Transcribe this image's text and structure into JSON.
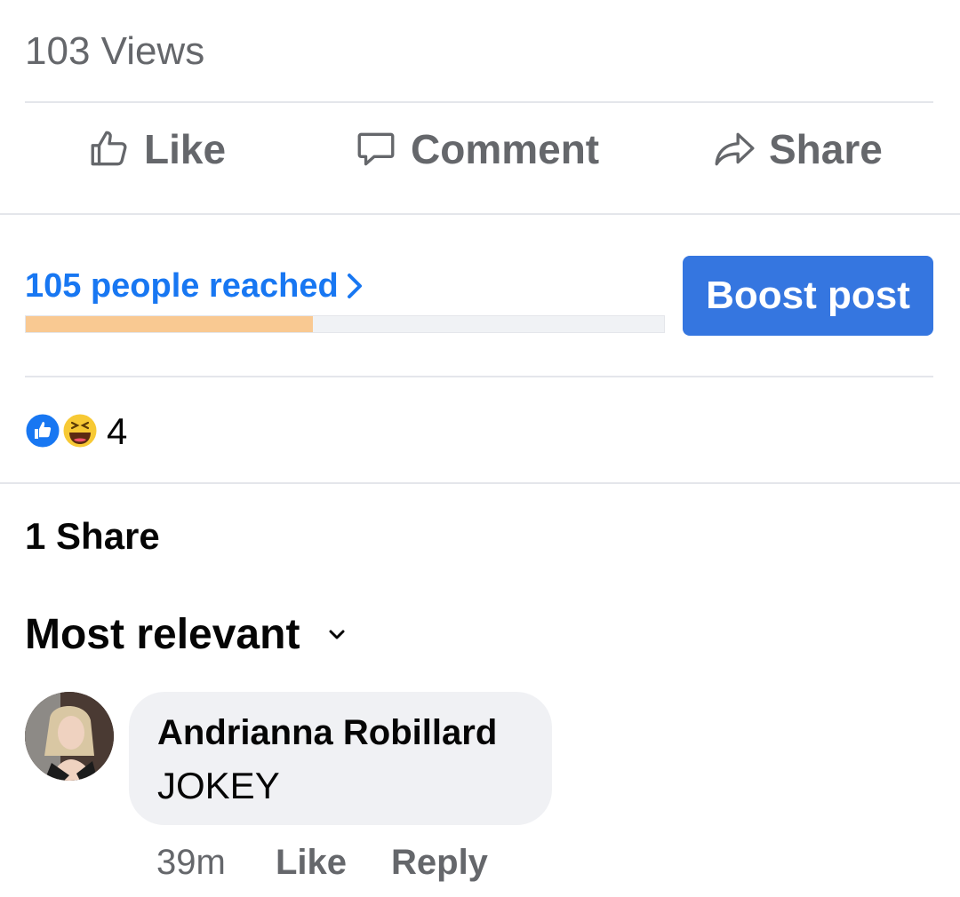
{
  "post": {
    "views_text": "103 Views",
    "actions": {
      "like": "Like",
      "comment": "Comment",
      "share": "Share"
    }
  },
  "insights": {
    "reach_text": "105 people reached",
    "progress_fraction": 0.45,
    "boost_label": "Boost post",
    "colors": {
      "link": "#1877f2",
      "boost_bg": "#3576e0",
      "bar_fill": "#f9c992"
    }
  },
  "reactions": {
    "icons": [
      "like-reaction-icon",
      "haha-reaction-icon"
    ],
    "count": "4"
  },
  "shares_text": "1 Share",
  "comments": {
    "sort_label": "Most relevant",
    "items": [
      {
        "author": "Andrianna Robillard",
        "text": "JOKEY",
        "time": "39m",
        "like_label": "Like",
        "reply_label": "Reply"
      }
    ]
  }
}
